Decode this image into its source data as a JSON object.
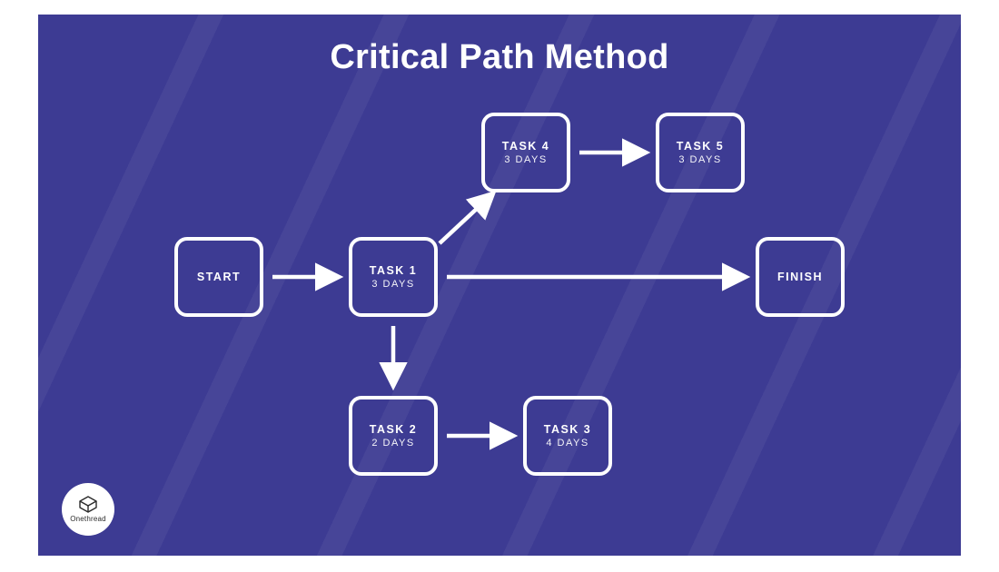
{
  "title": "Critical Path Method",
  "logo_text": "Onethread",
  "nodes": {
    "start": {
      "label": "START",
      "duration": ""
    },
    "task1": {
      "label": "TASK 1",
      "duration": "3 DAYS"
    },
    "task2": {
      "label": "TASK 2",
      "duration": "2 DAYS"
    },
    "task3": {
      "label": "TASK 3",
      "duration": "4 DAYS"
    },
    "task4": {
      "label": "TASK 4",
      "duration": "3 DAYS"
    },
    "task5": {
      "label": "TASK 5",
      "duration": "3 DAYS"
    },
    "finish": {
      "label": "FINISH",
      "duration": ""
    }
  },
  "edges": [
    {
      "from": "start",
      "to": "task1"
    },
    {
      "from": "task1",
      "to": "task4"
    },
    {
      "from": "task4",
      "to": "task5"
    },
    {
      "from": "task1",
      "to": "finish"
    },
    {
      "from": "task1",
      "to": "task2"
    },
    {
      "from": "task2",
      "to": "task3"
    }
  ]
}
